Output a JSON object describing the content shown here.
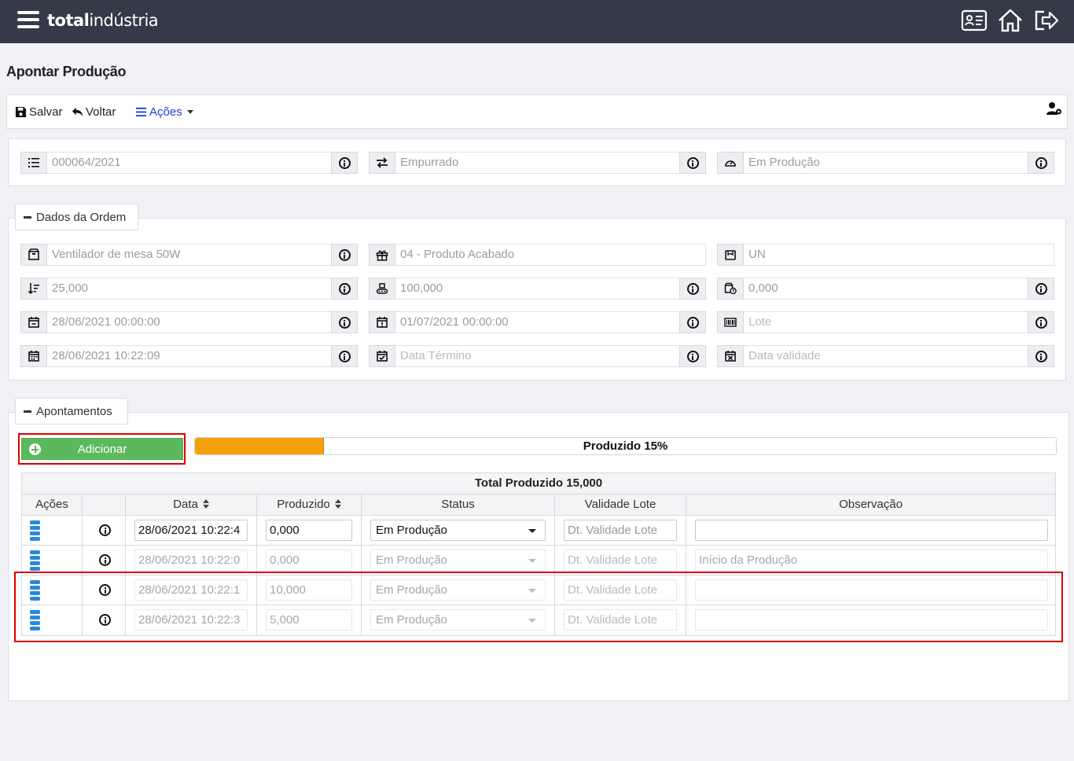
{
  "app": {
    "logo_bold": "total",
    "logo_light": "indústria"
  },
  "page": {
    "title": "Apontar Produção"
  },
  "toolbar": {
    "save_label": "Salvar",
    "back_label": "Voltar",
    "actions_label": "Ações"
  },
  "header_fields": {
    "order_number": "000064/2021",
    "push_type": "Empurrado",
    "status": "Em Produção"
  },
  "order_section": {
    "legend": "Dados da Ordem",
    "product": "Ventilador de mesa 50W",
    "product_type": "04 - Produto Acabado",
    "unit": "UN",
    "qty_planned": "25,000",
    "qty_capacity": "100,000",
    "qty_other": "0,000",
    "date_start_planned": "28/06/2021 00:00:00",
    "date_end_planned": "01/07/2021 00:00:00",
    "lot_placeholder": "Lote",
    "date_start": "28/06/2021 10:22:09",
    "date_end_placeholder": "Data Término",
    "validity_placeholder": "Data validade"
  },
  "entries_section": {
    "legend": "Apontamentos",
    "add_label": "Adicionar",
    "progress_label": "Produzido 15%",
    "progress_fraction": 0.15,
    "total_label": "Total Produzido 15,000",
    "columns": [
      "Ações",
      "",
      "Data",
      "Produzido",
      "Status",
      "Validade Lote",
      "Observação"
    ],
    "rows": [
      {
        "date": "28/06/2021 10:22:4",
        "produced": "0,000",
        "status": "Em Produção",
        "validity_placeholder": "Dt. Validade Lote",
        "note": ""
      },
      {
        "date": "28/06/2021 10:22:0",
        "produced": "0,000",
        "status": "Em Produção",
        "validity_placeholder": "Dt. Validade Lote",
        "note": "Início da Produção"
      },
      {
        "date": "28/06/2021 10:22:1",
        "produced": "10,000",
        "status": "Em Produção",
        "validity_placeholder": "Dt. Validade Lote",
        "note": ""
      },
      {
        "date": "28/06/2021 10:22:3",
        "produced": "5,000",
        "status": "Em Produção",
        "validity_placeholder": "Dt. Validade Lote",
        "note": ""
      }
    ]
  },
  "colors": {
    "topbar": "#353a48",
    "add_button": "#5cb85c",
    "progress_fill": "#f7a00d",
    "highlight": "#dd0000",
    "accent_link": "#1a3fd6"
  }
}
